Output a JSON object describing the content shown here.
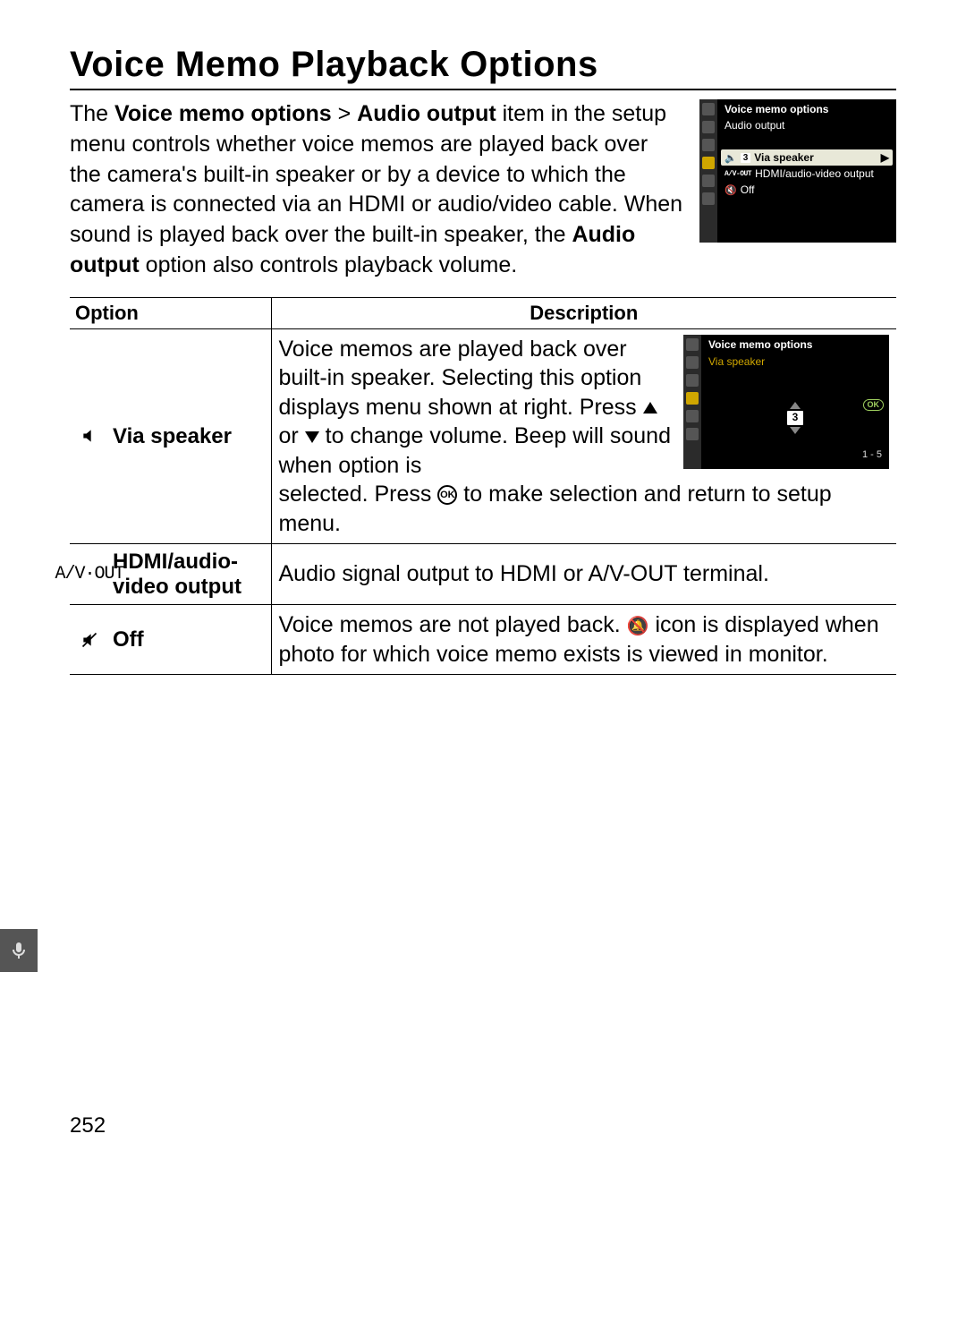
{
  "page_title": "Voice Memo Playback Options",
  "intro": {
    "part1": "The ",
    "bold1": "Voice memo options",
    "gt": " > ",
    "bold2": "Audio output",
    "part2": " item in the setup menu controls whether voice memos are played back over the camera's built-in speaker or by a device to which the camera is connected via an HDMI or audio/video cable.  When sound is played back over the built-in speaker, the ",
    "bold3": "Audio output",
    "part3": " option also controls playback volume."
  },
  "screenshot1": {
    "title": "Voice memo options",
    "subtitle": "Audio output",
    "opt1_level": "3",
    "opt1_label": "Via speaker",
    "opt2_prefix": "A/V-OUT",
    "opt2_label": "HDMI/audio-video output",
    "opt3_label": "Off"
  },
  "table": {
    "head_option": "Option",
    "head_desc": "Description",
    "row1": {
      "label": "Via speaker",
      "desc_a": "Voice memos are played back over built-in speaker. Selecting this option displays menu shown at right.  Press ",
      "desc_b": " or ",
      "desc_c": " to change volume.  Beep will sound when option is selected.  Press ",
      "desc_d": " to make selection and return to setup menu."
    },
    "row2": {
      "label": "HDMI/audio-video output",
      "icon_text": "A/V·OUT",
      "desc": "Audio signal output to HDMI or A/V-OUT terminal."
    },
    "row3": {
      "label": "Off",
      "desc_a": "Voice memos are not played back.  ",
      "desc_b": " icon is displayed when photo for which voice memo exists is viewed in monitor."
    }
  },
  "screenshot2": {
    "title": "Voice memo options",
    "subtitle": "Via speaker",
    "level": "3",
    "range": "1 - 5",
    "ok": "OK"
  },
  "page_number": "252",
  "icons": {
    "speaker": "🔈",
    "mute": "🔇",
    "mute_strike": "🔕",
    "chev_right": "▶"
  }
}
